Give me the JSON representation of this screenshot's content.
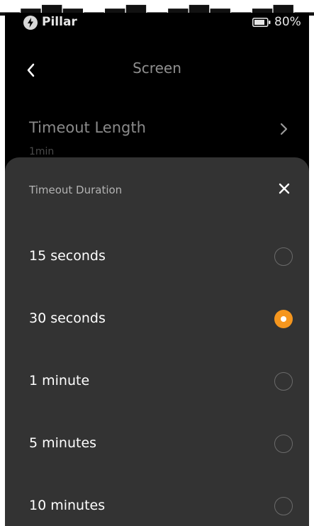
{
  "status_bar": {
    "carrier": "Pillar",
    "status_icon": "bolt-icon",
    "battery_icon": "battery-icon",
    "battery_percent": "80%"
  },
  "nav": {
    "back_icon": "chevron-left-icon",
    "title": "Screen"
  },
  "setting_row": {
    "title": "Timeout Length",
    "value": "1min",
    "chevron_icon": "chevron-right-icon"
  },
  "sheet": {
    "title": "Timeout Duration",
    "close_icon": "close-icon",
    "selected_index": 1,
    "options": [
      {
        "label": "15 seconds",
        "selected": false
      },
      {
        "label": "30 seconds",
        "selected": true
      },
      {
        "label": "1 minute",
        "selected": false
      },
      {
        "label": "5 minutes",
        "selected": false
      },
      {
        "label": "10 minutes",
        "selected": false
      }
    ]
  },
  "colors": {
    "background": "#000000",
    "sheet_background": "#333333",
    "accent": "#f5961e"
  }
}
